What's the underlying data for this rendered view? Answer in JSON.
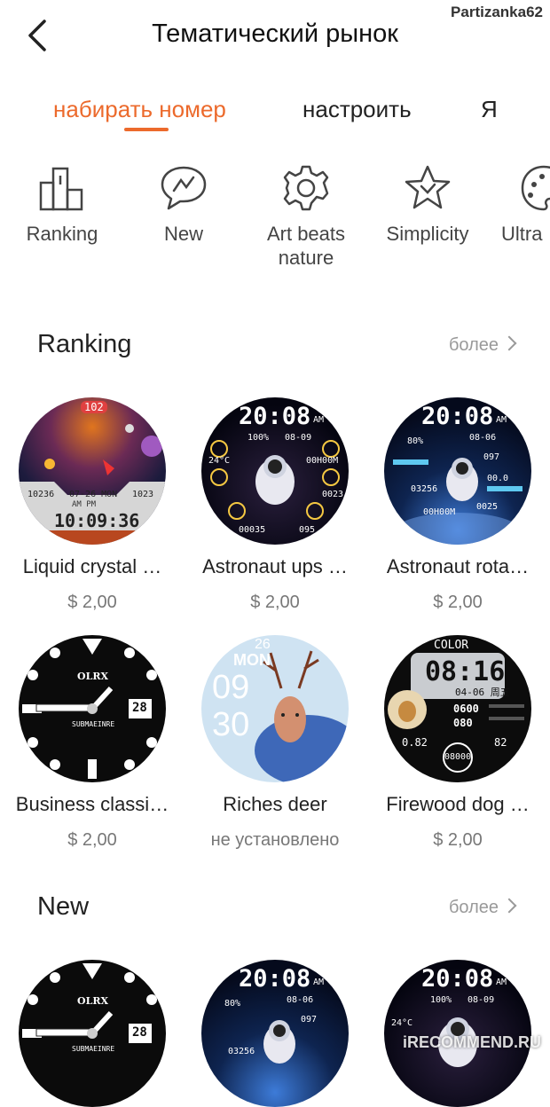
{
  "watermark_user": "Partizanka62",
  "header": {
    "title": "Тематический рынок"
  },
  "tabs": [
    {
      "label": "набирать номер"
    },
    {
      "label": "настроить"
    },
    {
      "label": "Я"
    }
  ],
  "categories": [
    {
      "label": "Ranking",
      "icon": "ranking-icon"
    },
    {
      "label": "New",
      "icon": "chat-bubble-icon"
    },
    {
      "label": "Art beats nature",
      "icon": "gear-icon"
    },
    {
      "label": "Simplicity",
      "icon": "star-icon"
    },
    {
      "label": "Ultra",
      "icon": "palette-icon"
    }
  ],
  "sections": {
    "ranking": {
      "title": "Ranking",
      "more": "более",
      "items": [
        {
          "title": "Liquid crystal …",
          "price": "$ 2,00"
        },
        {
          "title": "Astronaut ups …",
          "price": "$ 2,00"
        },
        {
          "title": "Astronaut rota…",
          "price": "$ 2,00"
        },
        {
          "title": "Business classi…",
          "price": "$ 2,00"
        },
        {
          "title": "Riches deer",
          "price": "не установлено"
        },
        {
          "title": "Firewood dog …",
          "price": "$ 2,00"
        }
      ]
    },
    "new": {
      "title": "New",
      "more": "более"
    }
  },
  "faces": {
    "liquid": {
      "top": "102",
      "steps": "10236",
      "date": "07-26 MON",
      "right": "1023",
      "ampm": "AM PM",
      "time": "10:09:36"
    },
    "astro1": {
      "time": "20:08",
      "ampm": "AM",
      "battery": "100%",
      "date": "08-09",
      "temp": "24°C",
      "hm": "00H00M",
      "v1": "0023",
      "v2": "00035",
      "v3": "095"
    },
    "astro2": {
      "time": "20:08",
      "ampm": "AM",
      "pct": "80%",
      "date": "08-06",
      "v1": "097",
      "v2": "03256",
      "v3": "00.0",
      "v4": "0025",
      "hm": "00H00M"
    },
    "rolex": {
      "brand": "OLRX",
      "sub": "SUBMAEINRE",
      "date": "28"
    },
    "deer": {
      "day": "26",
      "dow": "MON",
      "h": "09",
      "m": "30"
    },
    "dog": {
      "color": "COLOR",
      "time": "08:16",
      "date": "04-06 周五",
      "v1": "0600",
      "v2": "080",
      "l": "0.82",
      "r": "82",
      "c": "08000"
    }
  },
  "watermark_site": "iRECOMMEND.RU",
  "colors": {
    "accent": "#ec6a2c"
  }
}
